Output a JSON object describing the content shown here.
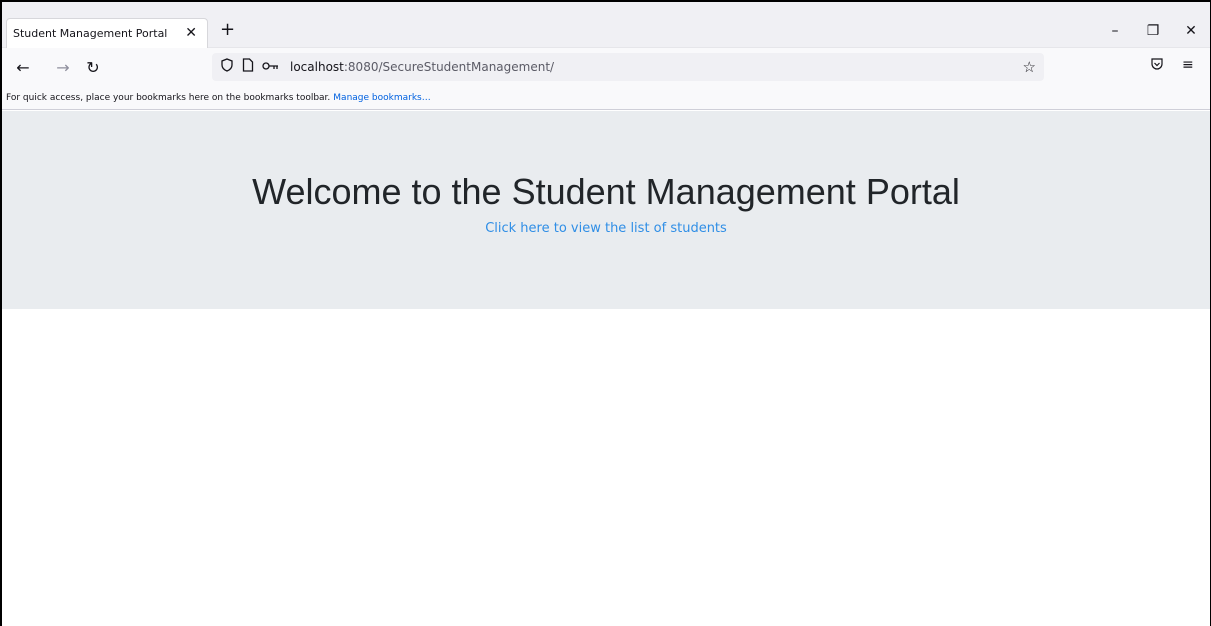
{
  "browser": {
    "tab": {
      "title": "Student Management Portal",
      "close_icon": "close-icon"
    },
    "new_tab_icon": "plus-icon",
    "window_controls": {
      "minimize": "–",
      "restore": "❐",
      "close": "✕"
    },
    "nav": {
      "back_icon": "arrow-left-icon",
      "forward_icon": "arrow-right-icon",
      "reload_icon": "reload-icon"
    },
    "url": {
      "host": "localhost",
      "path": ":8080/SecureStudentManagement/"
    },
    "bookmarks_bar": {
      "message": "For quick access, place your bookmarks here on the bookmarks toolbar.",
      "link": "Manage bookmarks…"
    }
  },
  "page": {
    "title": "Welcome to the Student Management Portal",
    "link_text": "Click here to view the list of students"
  }
}
